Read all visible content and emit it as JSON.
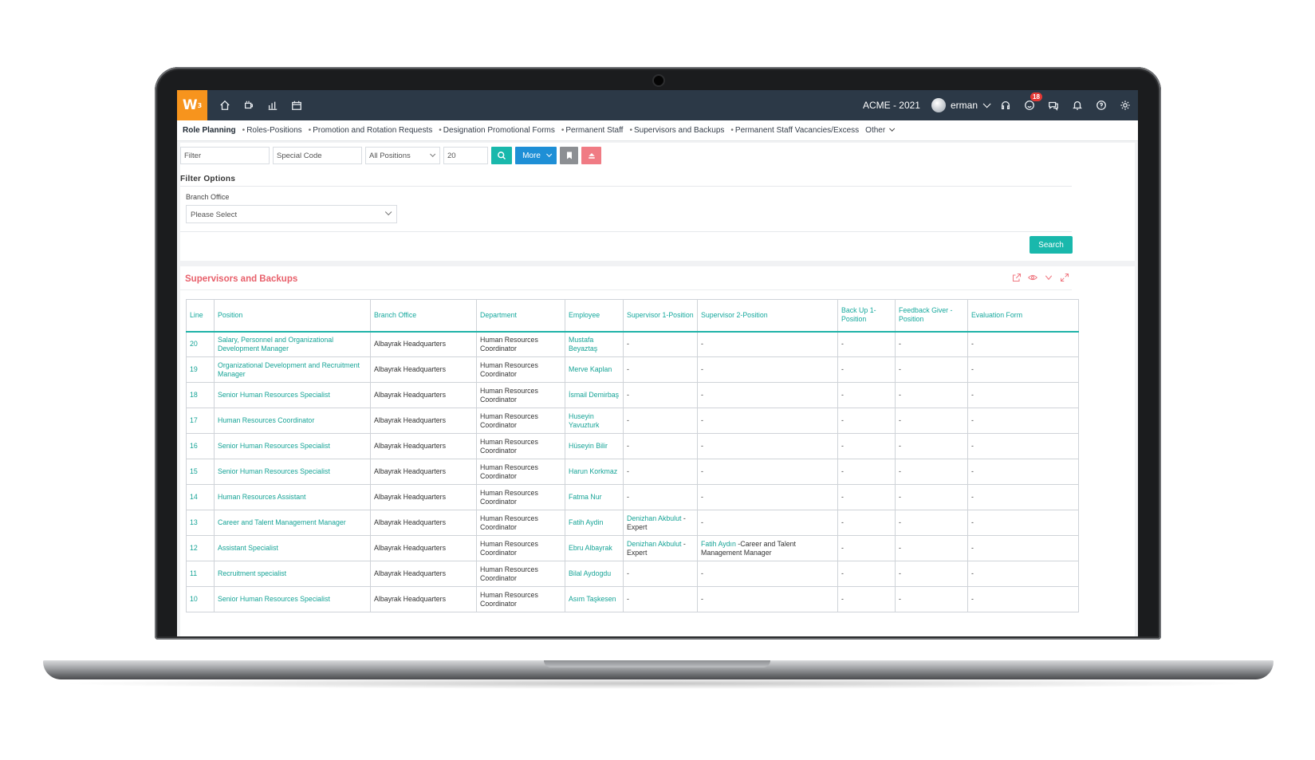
{
  "topbar": {
    "logo": "W",
    "logo_sup": "3",
    "nav_icons": [
      "home-icon",
      "coffee-icon",
      "chart-icon",
      "calendar-icon"
    ],
    "company": "ACME - 2021",
    "user": "erman",
    "notification_count": "18"
  },
  "submenu": {
    "active": "Role Planning",
    "items": [
      "Roles-Positions",
      "Promotion and Rotation Requests",
      "Designation Promotional Forms",
      "Permanent Staff",
      "Supervisors and Backups",
      "Permanent Staff Vacancies/Excess"
    ],
    "other": "Other"
  },
  "filters": {
    "filter_placeholder": "Filter",
    "special_code_placeholder": "Special Code",
    "positions_value": "All Positions",
    "page_size": "20",
    "more_label": "More",
    "options_title": "Filter Options",
    "branch_label": "Branch Office",
    "branch_value": "Please Select",
    "search_label": "Search"
  },
  "colors": {
    "accent": "#19b8ac",
    "more": "#1e8fd6",
    "title": "#e8606b",
    "topbar": "#2c3947",
    "logo": "#f7941d"
  },
  "results": {
    "title": "Supervisors and Backups",
    "columns": [
      "Line",
      "Position",
      "Branch Office",
      "Department",
      "Employee",
      "Supervisor 1-Position",
      "Supervisor 2-Position",
      "Back Up 1-Position",
      "Feedback Giver - Position",
      "Evaluation Form"
    ],
    "rows": [
      {
        "line": "20",
        "position": "Salary, Personnel and Organizational Development Manager",
        "branch": "Albayrak Headquarters",
        "dept": "Human Resources Coordinator",
        "employee": "Mustafa Beyaztaş",
        "sup1": "-",
        "sup2": "-",
        "backup": "-",
        "feedback": "-",
        "eval": "-"
      },
      {
        "line": "19",
        "position": "Organizational Development and Recruitment Manager",
        "branch": "Albayrak Headquarters",
        "dept": "Human Resources Coordinator",
        "employee": "Merve Kaplan",
        "sup1": "-",
        "sup2": "-",
        "backup": "-",
        "feedback": "-",
        "eval": "-"
      },
      {
        "line": "18",
        "position": "Senior Human Resources Specialist",
        "branch": "Albayrak Headquarters",
        "dept": "Human Resources Coordinator",
        "employee": "İsmail Demirbaş",
        "sup1": "-",
        "sup2": "-",
        "backup": "-",
        "feedback": "-",
        "eval": "-"
      },
      {
        "line": "17",
        "position": "Human Resources Coordinator",
        "branch": "Albayrak Headquarters",
        "dept": "Human Resources Coordinator",
        "employee": "Huseyin Yavuzturk",
        "sup1": "-",
        "sup2": "-",
        "backup": "-",
        "feedback": "-",
        "eval": "-"
      },
      {
        "line": "16",
        "position": "Senior Human Resources Specialist",
        "branch": "Albayrak Headquarters",
        "dept": "Human Resources Coordinator",
        "employee": "Hüseyin Bilir",
        "sup1": "-",
        "sup2": "-",
        "backup": "-",
        "feedback": "-",
        "eval": "-"
      },
      {
        "line": "15",
        "position": "Senior Human Resources Specialist",
        "branch": "Albayrak Headquarters",
        "dept": "Human Resources Coordinator",
        "employee": "Harun Korkmaz",
        "sup1": "-",
        "sup2": "-",
        "backup": "-",
        "feedback": "-",
        "eval": "-"
      },
      {
        "line": "14",
        "position": "Human Resources Assistant",
        "branch": "Albayrak Headquarters",
        "dept": "Human Resources Coordinator",
        "employee": "Fatma Nur",
        "sup1": "-",
        "sup2": "-",
        "backup": "-",
        "feedback": "-",
        "eval": "-"
      },
      {
        "line": "13",
        "position": "Career and Talent Management Manager",
        "branch": "Albayrak Headquarters",
        "dept": "Human Resources Coordinator",
        "employee": "Fatih Aydin",
        "sup1": "Denizhan Akbulut",
        "sup1_suffix": " - Expert",
        "sup2": "-",
        "backup": "-",
        "feedback": "-",
        "eval": "-"
      },
      {
        "line": "12",
        "position": "Assistant Specialist",
        "branch": "Albayrak Headquarters",
        "dept": "Human Resources Coordinator",
        "employee": "Ebru Albayrak",
        "sup1": "Denizhan Akbulut",
        "sup1_suffix": " - Expert",
        "sup2": "Fatih Aydın",
        "sup2_suffix": " -Career and Talent Management Manager",
        "backup": "-",
        "feedback": "-",
        "eval": "-"
      },
      {
        "line": "11",
        "position": "Recruitment specialist",
        "branch": "Albayrak Headquarters",
        "dept": "Human Resources Coordinator",
        "employee": "Bilal Aydogdu",
        "sup1": "-",
        "sup2": "-",
        "backup": "-",
        "feedback": "-",
        "eval": "-"
      },
      {
        "line": "10",
        "position": "Senior Human Resources Specialist",
        "branch": "Albayrak Headquarters",
        "dept": "Human Resources Coordinator",
        "employee": "Asım Taşkesen",
        "sup1": "-",
        "sup2": "-",
        "backup": "-",
        "feedback": "-",
        "eval": "-"
      }
    ]
  }
}
